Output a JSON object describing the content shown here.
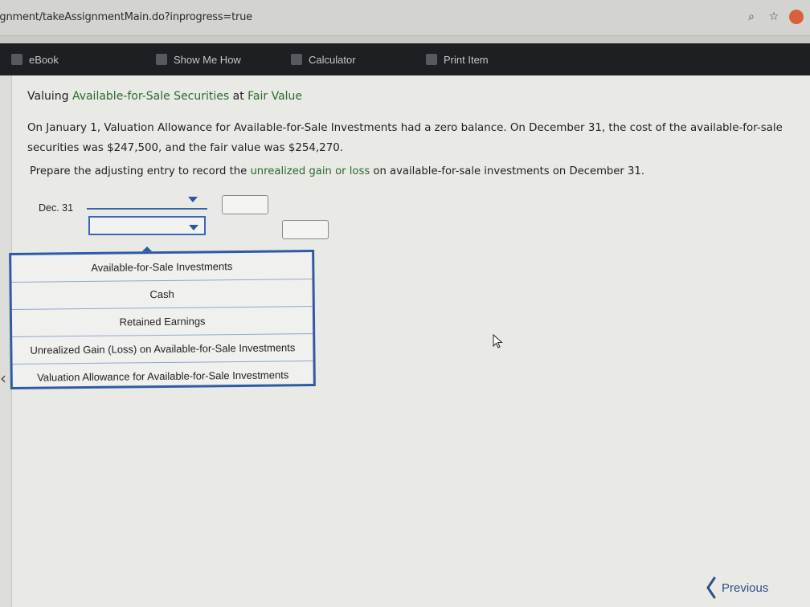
{
  "browser": {
    "url": "ignment/takeAssignmentMain.do?inprogress=true",
    "icons": [
      "zoom-icon",
      "star-icon",
      "profile-icon"
    ]
  },
  "toolbar": {
    "items": [
      {
        "label": "eBook",
        "icon": "book-icon"
      },
      {
        "label": "Show Me How",
        "icon": "video-icon"
      },
      {
        "label": "Calculator",
        "icon": "calculator-icon"
      },
      {
        "label": "Print Item",
        "icon": "print-icon"
      }
    ]
  },
  "problem": {
    "title_prefix": "Valuing ",
    "title_link": "Available-for-Sale Securities",
    "title_mid": " at ",
    "title_link2": "Fair Value",
    "para": "On January 1, Valuation Allowance for Available-for-Sale Investments had a zero balance. On December 31, the cost of the available-for-sale securities was $247,500, and the fair value was $254,270.",
    "prompt_prefix": "Prepare the adjusting entry to record the ",
    "prompt_link": "unrealized gain or loss",
    "prompt_suffix": " on available-for-sale investments on December 31."
  },
  "journal": {
    "date": "Dec. 31"
  },
  "dropdown": {
    "options": [
      "Available-for-Sale Investments",
      "Cash",
      "Retained Earnings",
      "Unrealized Gain (Loss) on Available-for-Sale Investments",
      "Valuation Allowance for Available-for-Sale Investments"
    ]
  },
  "nav": {
    "previous_label": "Previous"
  },
  "colors": {
    "accent": "#2f5aa6",
    "link_green": "#2c6a2c",
    "toolbar_bg": "#1d1f22"
  }
}
